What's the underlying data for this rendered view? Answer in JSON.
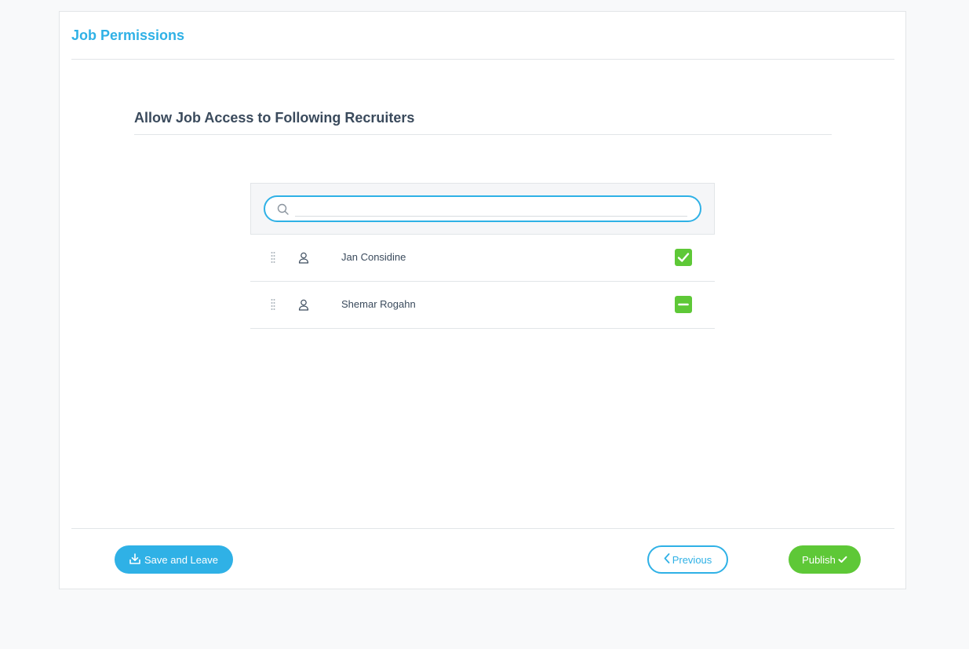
{
  "card": {
    "title": "Job Permissions"
  },
  "section": {
    "title": "Allow Job Access to Following Recruiters"
  },
  "search": {
    "value": "",
    "placeholder": "",
    "icon": "search-icon"
  },
  "recruiters": [
    {
      "name": "Jan Considine",
      "state": "checked"
    },
    {
      "name": "Shemar Rogahn",
      "state": "indeterminate"
    }
  ],
  "footer": {
    "save_label": "Save and Leave",
    "previous_label": "Previous",
    "publish_label": "Publish"
  },
  "colors": {
    "accent": "#2fb1e6",
    "success": "#5ec837",
    "heading": "#3a4a5c"
  }
}
